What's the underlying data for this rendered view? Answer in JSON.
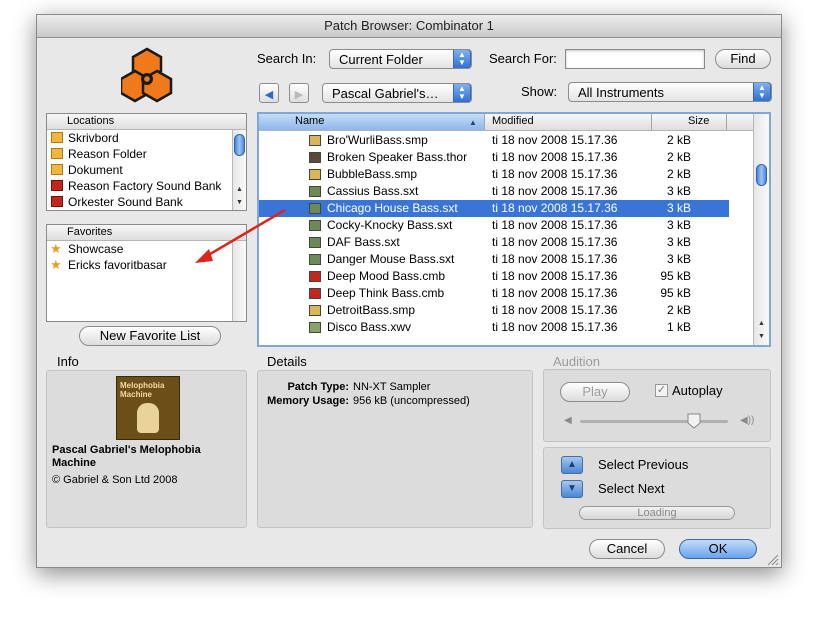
{
  "window": {
    "title": "Patch Browser: Combinator 1"
  },
  "search": {
    "search_in_label": "Search In:",
    "search_in_value": "Current Folder",
    "search_for_label": "Search For:",
    "search_for_value": "",
    "find_label": "Find"
  },
  "nav": {
    "back_icon": "◀",
    "forward_icon": "▶",
    "folder_popup": "Pascal Gabriel's…",
    "show_label": "Show:",
    "show_value": "All Instruments"
  },
  "locations": {
    "header": "Locations",
    "items": [
      {
        "label": "Skrivbord",
        "icon": "desktop-folder-icon"
      },
      {
        "label": "Reason Folder",
        "icon": "reason-folder-icon"
      },
      {
        "label": "Dokument",
        "icon": "documents-folder-icon"
      },
      {
        "label": "Reason Factory Sound Bank",
        "icon": "soundbank-icon"
      },
      {
        "label": "Orkester Sound Bank",
        "icon": "soundbank-icon"
      }
    ]
  },
  "favorites": {
    "header": "Favorites",
    "items": [
      {
        "label": "Showcase",
        "icon": "star-icon"
      },
      {
        "label": "Ericks favoritbasar",
        "icon": "star-icon"
      }
    ],
    "new_list_label": "New Favorite List"
  },
  "files": {
    "columns": {
      "name": "Name",
      "modified": "Modified",
      "size": "Size"
    },
    "rows": [
      {
        "name": "Bro'WurliBass.smp",
        "modified": "ti 18 nov 2008 15.17.36",
        "size": "2 kB"
      },
      {
        "name": "Broken Speaker Bass.thor",
        "modified": "ti 18 nov 2008 15.17.36",
        "size": "2 kB"
      },
      {
        "name": "BubbleBass.smp",
        "modified": "ti 18 nov 2008 15.17.36",
        "size": "2 kB"
      },
      {
        "name": "Cassius Bass.sxt",
        "modified": "ti 18 nov 2008 15.17.36",
        "size": "3 kB"
      },
      {
        "name": "Chicago House Bass.sxt",
        "modified": "ti 18 nov 2008 15.17.36",
        "size": "3 kB",
        "selected": true
      },
      {
        "name": "Cocky-Knocky Bass.sxt",
        "modified": "ti 18 nov 2008 15.17.36",
        "size": "3 kB"
      },
      {
        "name": "DAF Bass.sxt",
        "modified": "ti 18 nov 2008 15.17.36",
        "size": "3 kB"
      },
      {
        "name": "Danger Mouse Bass.sxt",
        "modified": "ti 18 nov 2008 15.17.36",
        "size": "3 kB"
      },
      {
        "name": "Deep Mood Bass.cmb",
        "modified": "ti 18 nov 2008 15.17.36",
        "size": "95 kB"
      },
      {
        "name": "Deep Think Bass.cmb",
        "modified": "ti 18 nov 2008 15.17.36",
        "size": "95 kB"
      },
      {
        "name": "DetroitBass.smp",
        "modified": "ti 18 nov 2008 15.17.36",
        "size": "2 kB"
      },
      {
        "name": "Disco Bass.xwv",
        "modified": "ti 18 nov 2008 15.17.36",
        "size": "1 kB"
      }
    ]
  },
  "info": {
    "title": "Info",
    "album_art_text": "Melophobia Machine",
    "bank_name": "Pascal Gabriel's Melophobia Machine",
    "copyright": "© Gabriel & Son Ltd 2008"
  },
  "details": {
    "title": "Details",
    "patch_type_label": "Patch Type:",
    "patch_type_value": "NN-XT Sampler",
    "memory_label": "Memory Usage:",
    "memory_value": "956 kB (uncompressed)"
  },
  "audition": {
    "title": "Audition",
    "play_label": "Play",
    "autoplay_label": "Autoplay",
    "autoplay_checked": true,
    "volume_level": 0.77,
    "select_previous": "Select Previous",
    "select_next": "Select Next",
    "loading_label": "Loading"
  },
  "footer": {
    "cancel": "Cancel",
    "ok": "OK"
  },
  "colors": {
    "selection": "#3875d7",
    "accent_blue": "#4b86d4",
    "reason_orange": "#f07a1a",
    "arrow_red": "#e0231b"
  }
}
